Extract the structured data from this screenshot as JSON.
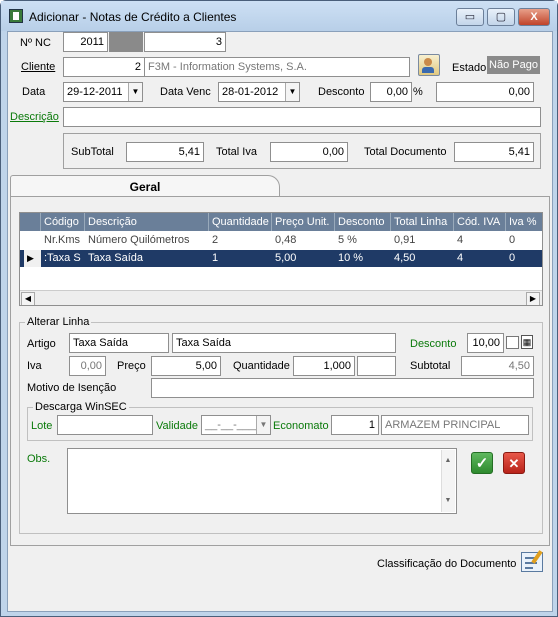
{
  "window": {
    "title": "Adicionar - Notas de Crédito a Clientes",
    "min": "▭",
    "max": "▢",
    "close": "X"
  },
  "header": {
    "nnc_label": "Nº NC",
    "nnc_year": "2011",
    "nnc_number": "3",
    "cliente_label": "Cliente",
    "cliente_code": "2",
    "cliente_name": "F3M - Information Systems, S.A.",
    "estado_label": "Estado",
    "estado_value": "Não Pago",
    "data_label": "Data",
    "data_value": "29-12-2011",
    "datavenc_label": "Data Venc",
    "datavenc_value": "28-01-2012",
    "desconto_label": "Desconto",
    "desconto_pct": "0,00",
    "pct_sign": "%",
    "desconto_value": "0,00",
    "descricao_label": "Descrição",
    "descricao_value": ""
  },
  "totals": {
    "subtotal_label": "SubTotal",
    "subtotal": "5,41",
    "totaliva_label": "Total Iva",
    "totaliva": "0,00",
    "totaldoc_label": "Total Documento",
    "totaldoc": "5,41"
  },
  "tabs": {
    "geral": "Geral"
  },
  "grid": {
    "columns": [
      "Código",
      "Descrição",
      "Quantidade",
      "Preço Unit.",
      "Desconto",
      "Total Linha",
      "Cód. IVA",
      "Iva %"
    ],
    "rows": [
      [
        "Nr.Kms",
        "Número Quilómetros",
        "2",
        "0,48",
        "5 %",
        "0,91",
        "4",
        "0"
      ],
      [
        ":Taxa S",
        "Taxa Saída",
        "1",
        "5,00",
        "10 %",
        "4,50",
        "4",
        "0"
      ]
    ],
    "row_indicator": "▶"
  },
  "alterar": {
    "title": "Alterar Linha",
    "artigo_label": "Artigo",
    "artigo_code": "Taxa Saída",
    "artigo_desc": "Taxa Saída",
    "desconto_label": "Desconto",
    "desconto_value": "10,00",
    "iva_label": "Iva",
    "iva_value": "0,00",
    "preco_label": "Preço",
    "preco_value": "5,00",
    "quantidade_label": "Quantidade",
    "quantidade_value": "1,000",
    "quantidade_extra": "",
    "subtotal_label": "Subtotal",
    "subtotal_value": "4,50",
    "motivo_label": "Motivo de Isenção",
    "motivo_value": "",
    "descarga_title": "Descarga WinSEC",
    "lote_label": "Lote",
    "lote_value": "",
    "validade_label": "Validade",
    "validade_value": "__-__-____",
    "economato_label": "Economato",
    "economato_code": "1",
    "economato_name": "ARMAZEM PRINCIPAL",
    "obs_label": "Obs.",
    "obs_value": ""
  },
  "footer": {
    "classificacao": "Classificação do Documento"
  },
  "colors": {
    "accent": "#1f3a66",
    "label_green": "#0a7a0a",
    "grid_header": "#6a7f99"
  }
}
